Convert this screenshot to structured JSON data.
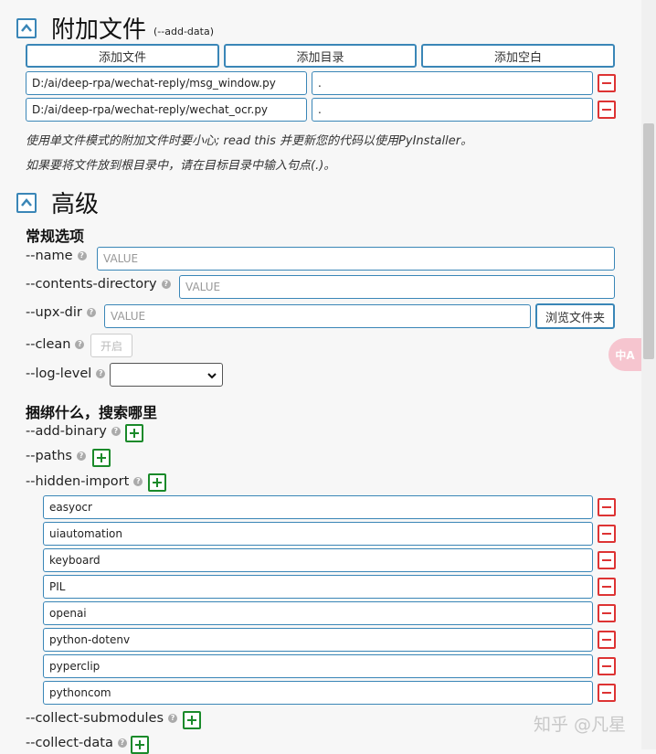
{
  "add_data": {
    "title": "附加文件",
    "subtitle": "(--add-data)",
    "buttons": {
      "add_file": "添加文件",
      "add_dir": "添加目录",
      "add_blank": "添加空白"
    },
    "rows": [
      {
        "source": "D:/ai/deep-rpa/wechat-reply/msg_window.py",
        "dest": "."
      },
      {
        "source": "D:/ai/deep-rpa/wechat-reply/wechat_ocr.py",
        "dest": "."
      }
    ],
    "note1": "使用单文件模式的附加文件时要小心; read this 并更新您的代码以使用PyInstaller。",
    "note2": "如果要将文件放到根目录中，请在目标目录中输入句点(.)。"
  },
  "advanced": {
    "title": "高级",
    "general_heading": "常规选项",
    "name_label": "--name",
    "contents_dir_label": "--contents-directory",
    "upx_dir_label": "--upx-dir",
    "clean_label": "--clean",
    "log_level_label": "--log-level",
    "value_placeholder": "VALUE",
    "browse_label": "浏览文件夹",
    "clean_toggle": "开启",
    "log_level_value": "",
    "bundle_heading": "捆绑什么，搜索哪里",
    "add_binary_label": "--add-binary",
    "paths_label": "--paths",
    "hidden_import_label": "--hidden-import",
    "hidden_imports": [
      "easyocr",
      "uiautomation",
      "keyboard",
      "PIL",
      "openai",
      "python-dotenv",
      "pyperclip",
      "pythoncom"
    ],
    "collect_submodules_label": "--collect-submodules",
    "collect_data_label": "--collect-data"
  },
  "overlay": {
    "translate_label": "中A",
    "watermark": "知乎 @凡星"
  },
  "colors": {
    "accent": "#3a86b7",
    "remove": "#dd3333",
    "add": "#1a8a2a"
  }
}
